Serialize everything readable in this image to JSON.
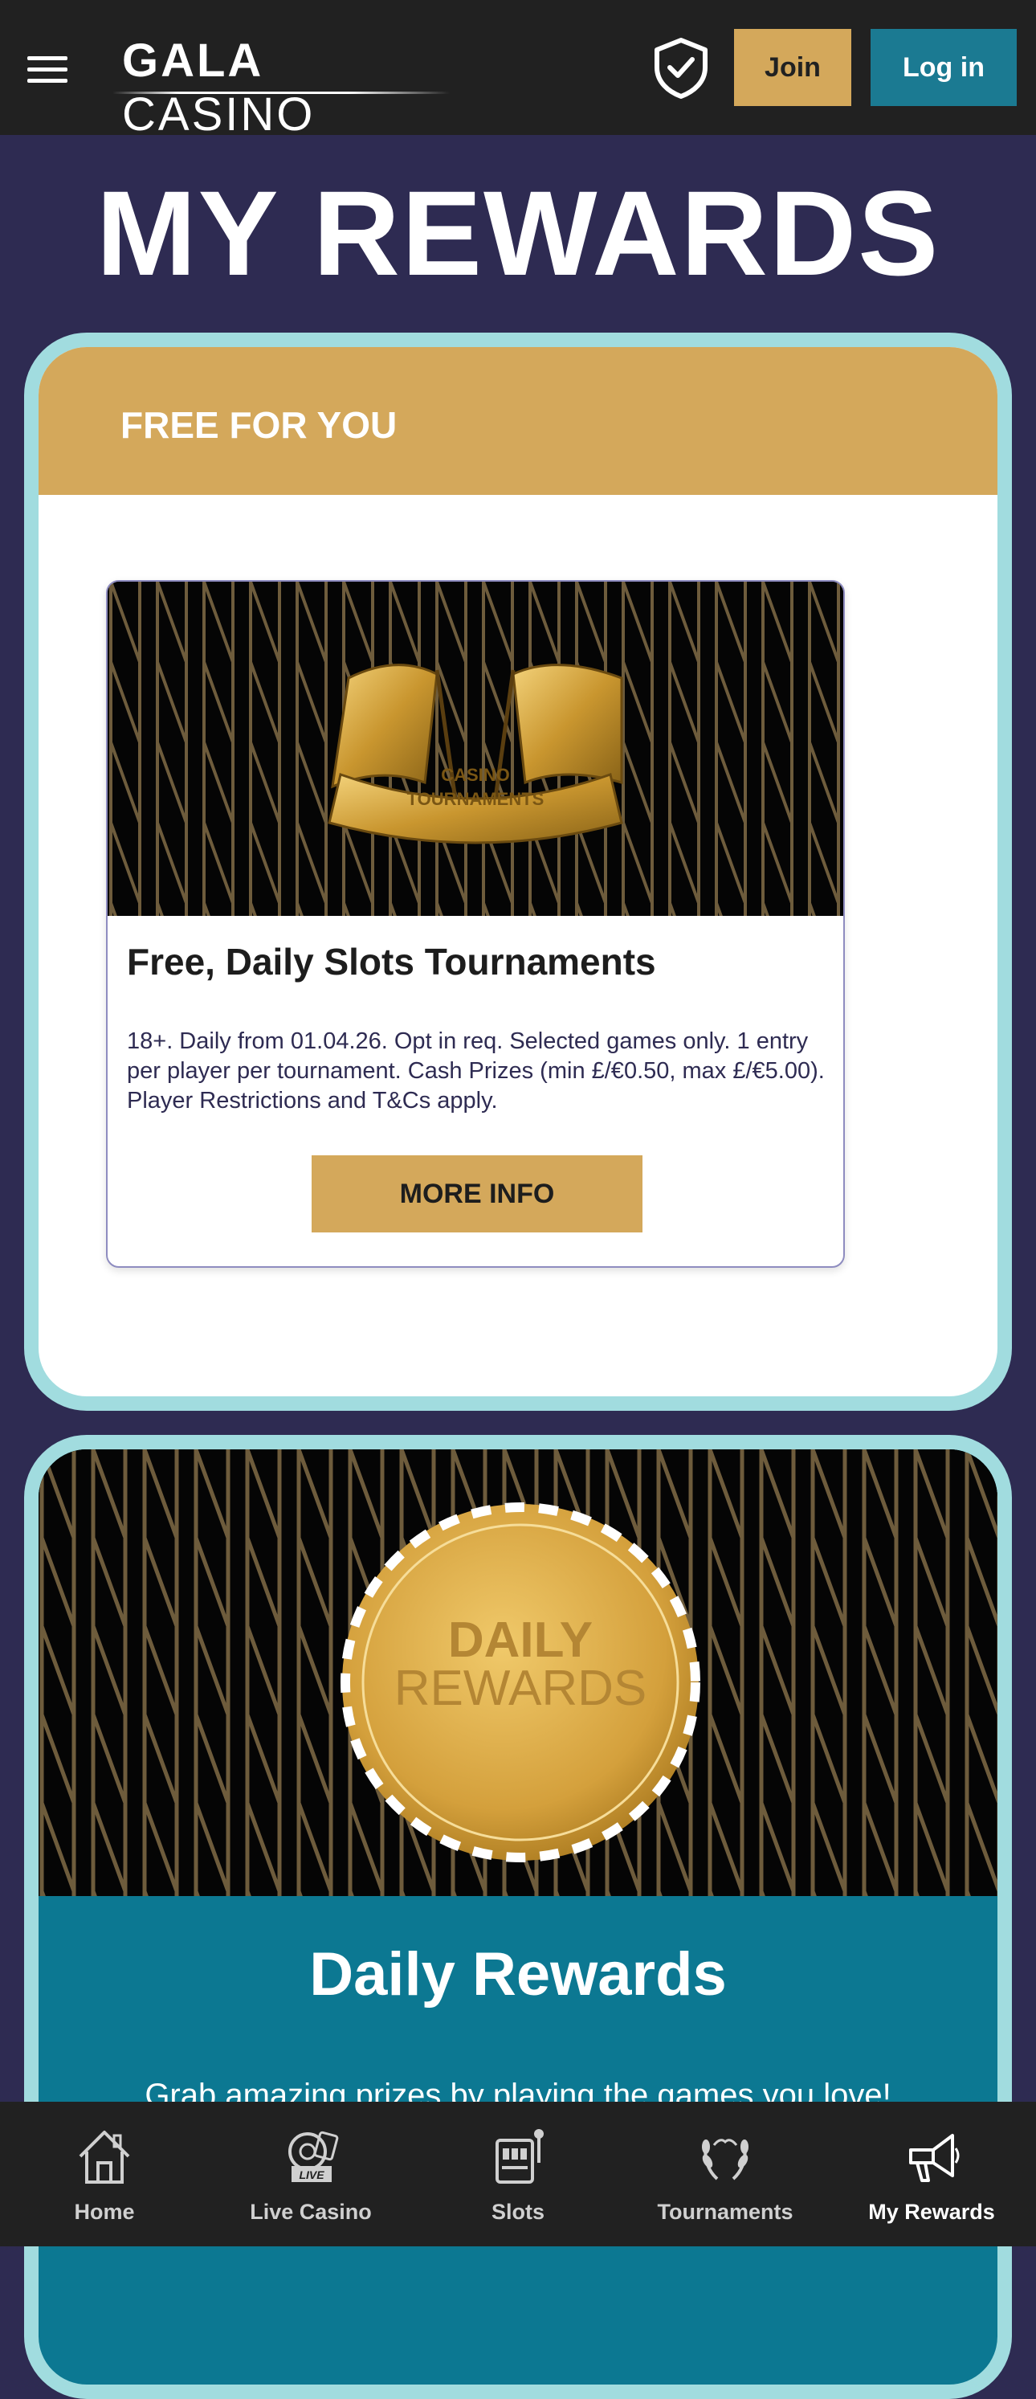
{
  "header": {
    "logo_text_bold": "GALA",
    "logo_text_light": "CASINO",
    "join_label": "Join",
    "login_label": "Log in"
  },
  "page": {
    "title": "MY REWARDS"
  },
  "free_section": {
    "heading": "FREE FOR YOU",
    "promo": {
      "banner_text_line1": "CASINO",
      "banner_text_line2": "TOURNAMENTS",
      "title": "Free, Daily Slots Tournaments",
      "terms": "18+. Daily from 01.04.26. Opt in req. Selected games only. 1 entry per player per tournament. Cash Prizes (min £/€0.50, max £/€5.00). Player Restrictions and T&Cs apply.",
      "button_label": "MORE INFO"
    }
  },
  "daily_section": {
    "coin_line1": "DAILY",
    "coin_line2": "REWARDS",
    "title": "Daily Rewards",
    "subtitle": "Grab amazing prizes by playing the games you love!"
  },
  "bottom_nav": {
    "items": [
      {
        "label": "Home",
        "icon": "home-icon"
      },
      {
        "label": "Live Casino",
        "icon": "live-casino-icon",
        "badge": "LIVE"
      },
      {
        "label": "Slots",
        "icon": "slot-machine-icon"
      },
      {
        "label": "Tournaments",
        "icon": "laurel-icon"
      },
      {
        "label": "My Rewards",
        "icon": "megaphone-icon",
        "active": true
      }
    ]
  },
  "colors": {
    "page_bg": "#2e2b52",
    "topbar_bg": "#212121",
    "gold": "#d4a85b",
    "teal": "#1b7a92",
    "card_border": "#a1dcdf"
  }
}
